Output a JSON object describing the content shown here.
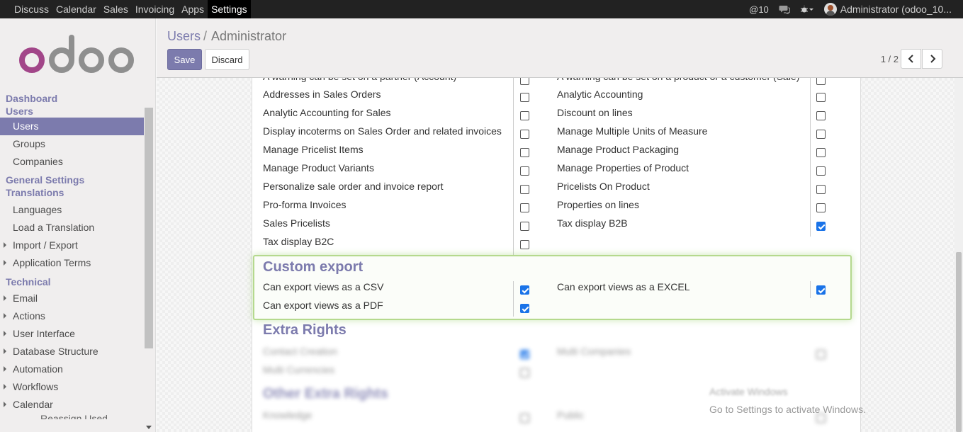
{
  "topbar": {
    "menu": [
      "Discuss",
      "Calendar",
      "Sales",
      "Invoicing",
      "Apps",
      "Settings"
    ],
    "active": "Settings",
    "notifications": "@10",
    "user": "Administrator (odoo_10..."
  },
  "sidebar": {
    "logo": "odoo",
    "sections": [
      {
        "title": "Dashboard"
      },
      {
        "title": "Users",
        "items": [
          "Users",
          "Groups",
          "Companies"
        ]
      },
      {
        "title": "General Settings"
      },
      {
        "title": "Translations",
        "items": [
          "Languages",
          "Load a Translation"
        ],
        "tree_items": [
          "Import / Export",
          "Application Terms"
        ]
      },
      {
        "title": "Technical",
        "tree_items": [
          "Email",
          "Actions",
          "User Interface",
          "Database Structure",
          "Automation",
          "Workflows",
          "Calendar"
        ]
      }
    ],
    "active_item": "Users",
    "cut_off_item": "Reassign Used..."
  },
  "breadcrumb": {
    "parent": "Users",
    "current": "Administrator"
  },
  "buttons": {
    "save": "Save",
    "discard": "Discard"
  },
  "pager": {
    "value": "1 / 2"
  },
  "rights": {
    "top_cut_left": "A warning can be set on a partner (Account)",
    "top_cut_right": "A warning can be set on a product or a customer (Sale)",
    "left": [
      {
        "label": "Addresses in Sales Orders",
        "checked": false
      },
      {
        "label": "Analytic Accounting for Sales",
        "checked": false
      },
      {
        "label": "Display incoterms on Sales Order and related invoices",
        "checked": false
      },
      {
        "label": "Manage Pricelist Items",
        "checked": false
      },
      {
        "label": "Manage Product Variants",
        "checked": false
      },
      {
        "label": "Personalize sale order and invoice report",
        "checked": false
      },
      {
        "label": "Pro-forma Invoices",
        "checked": false
      },
      {
        "label": "Sales Pricelists",
        "checked": false
      },
      {
        "label": "Tax display B2C",
        "checked": false
      }
    ],
    "right": [
      {
        "label": "Analytic Accounting",
        "checked": false
      },
      {
        "label": "Discount on lines",
        "checked": false
      },
      {
        "label": "Manage Multiple Units of Measure",
        "checked": false
      },
      {
        "label": "Manage Product Packaging",
        "checked": false
      },
      {
        "label": "Manage Properties of Product",
        "checked": false
      },
      {
        "label": "Pricelists On Product",
        "checked": false
      },
      {
        "label": "Properties on lines",
        "checked": false
      },
      {
        "label": "Tax display B2B",
        "checked": true
      }
    ]
  },
  "custom_export": {
    "title": "Custom export",
    "csv": "Can export views as a CSV",
    "excel": "Can export views as a EXCEL",
    "pdf": "Can export views as a PDF",
    "csv_checked": true,
    "excel_checked": true,
    "pdf_checked": true
  },
  "extra_rights": {
    "title": "Extra Rights",
    "contact_creation": "Contact Creation",
    "multi_companies": "Multi Companies",
    "multi_currencies": "Multi Currencies"
  },
  "other_extra": {
    "title": "Other Extra Rights",
    "left": "Knowledge",
    "right": "Public"
  },
  "watermark": {
    "title": "Activate Windows",
    "subtitle": "Go to Settings to activate Windows."
  },
  "colors": {
    "brand": "#7c7bad",
    "topbar": "#222222",
    "checkbox_checked": "#1a73e8",
    "highlight_border": "#b5d98e"
  }
}
